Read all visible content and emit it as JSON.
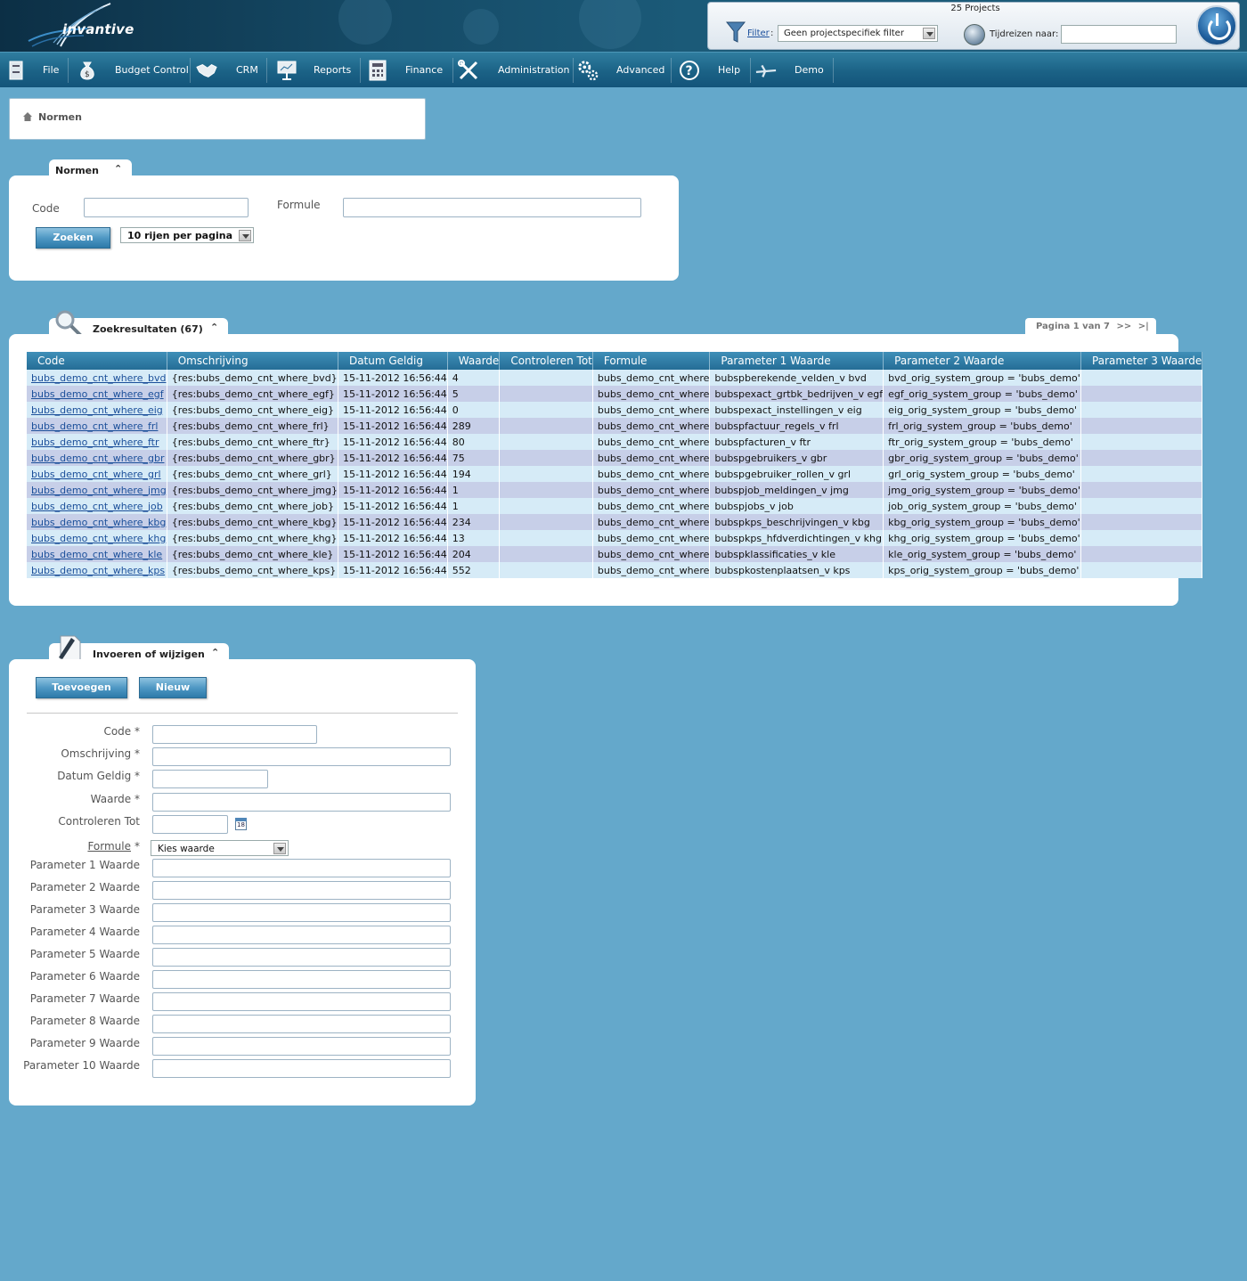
{
  "header": {
    "logo_text": "invantive",
    "project_count": "25 Projects",
    "filter_link": "Filter",
    "filter_colon": ":",
    "filter_value": "Geen projectspecifiek filter",
    "time_travel_label": "Tijdreizen naar:",
    "time_travel_value": ""
  },
  "menu": [
    {
      "label": "File",
      "icon": "cabinet-icon"
    },
    {
      "label": "Budget Control",
      "icon": "money-bag-icon"
    },
    {
      "label": "CRM",
      "icon": "handshake-icon"
    },
    {
      "label": "Reports",
      "icon": "presentation-icon"
    },
    {
      "label": "Finance",
      "icon": "calculator-icon"
    },
    {
      "label": "Administration",
      "icon": "tools-icon"
    },
    {
      "label": "Advanced",
      "icon": "gears-icon"
    },
    {
      "label": "Help",
      "icon": "question-icon"
    },
    {
      "label": "Demo",
      "icon": "airplane-icon"
    }
  ],
  "breadcrumb": {
    "text": "Normen"
  },
  "search": {
    "tab_title": "Normen",
    "code_label": "Code",
    "formule_label": "Formule",
    "search_button": "Zoeken",
    "rows_select": "10 rijen per pagina"
  },
  "results": {
    "tab_title": "Zoekresultaten (67)",
    "pager": "Pagina 1 van 7",
    "pager_next": ">>",
    "pager_last": ">|",
    "columns": [
      "Code",
      "Omschrijving",
      "Datum Geldig",
      "Waarde",
      "Controleren Tot",
      "Formule",
      "Parameter 1 Waarde",
      "Parameter 2 Waarde",
      "Parameter 3 Waarde"
    ],
    "rows": [
      [
        "bubs_demo_cnt_where_bvd",
        "{res:bubs_demo_cnt_where_bvd}",
        "15-11-2012 16:56:44",
        "4",
        "",
        "bubs_demo_cnt_where",
        "bubspberekende_velden_v bvd",
        "bvd_orig_system_group = 'bubs_demo'",
        ""
      ],
      [
        "bubs_demo_cnt_where_egf",
        "{res:bubs_demo_cnt_where_egf}",
        "15-11-2012 16:56:44",
        "5",
        "",
        "bubs_demo_cnt_where",
        "bubspexact_grtbk_bedrijven_v egf",
        "egf_orig_system_group = 'bubs_demo'",
        ""
      ],
      [
        "bubs_demo_cnt_where_eig",
        "{res:bubs_demo_cnt_where_eig}",
        "15-11-2012 16:56:44",
        "0",
        "",
        "bubs_demo_cnt_where",
        "bubspexact_instellingen_v eig",
        "eig_orig_system_group = 'bubs_demo'",
        ""
      ],
      [
        "bubs_demo_cnt_where_frl",
        "{res:bubs_demo_cnt_where_frl}",
        "15-11-2012 16:56:44",
        "289",
        "",
        "bubs_demo_cnt_where",
        "bubspfactuur_regels_v frl",
        "frl_orig_system_group = 'bubs_demo'",
        ""
      ],
      [
        "bubs_demo_cnt_where_ftr",
        "{res:bubs_demo_cnt_where_ftr}",
        "15-11-2012 16:56:44",
        "80",
        "",
        "bubs_demo_cnt_where",
        "bubspfacturen_v ftr",
        "ftr_orig_system_group = 'bubs_demo'",
        ""
      ],
      [
        "bubs_demo_cnt_where_gbr",
        "{res:bubs_demo_cnt_where_gbr}",
        "15-11-2012 16:56:44",
        "75",
        "",
        "bubs_demo_cnt_where",
        "bubspgebruikers_v gbr",
        "gbr_orig_system_group = 'bubs_demo'",
        ""
      ],
      [
        "bubs_demo_cnt_where_grl",
        "{res:bubs_demo_cnt_where_grl}",
        "15-11-2012 16:56:44",
        "194",
        "",
        "bubs_demo_cnt_where",
        "bubspgebruiker_rollen_v grl",
        "grl_orig_system_group = 'bubs_demo'",
        ""
      ],
      [
        "bubs_demo_cnt_where_jmg",
        "{res:bubs_demo_cnt_where_jmg}",
        "15-11-2012 16:56:44",
        "1",
        "",
        "bubs_demo_cnt_where",
        "bubspjob_meldingen_v jmg",
        "jmg_orig_system_group = 'bubs_demo'",
        ""
      ],
      [
        "bubs_demo_cnt_where_job",
        "{res:bubs_demo_cnt_where_job}",
        "15-11-2012 16:56:44",
        "1",
        "",
        "bubs_demo_cnt_where",
        "bubspjobs_v job",
        "job_orig_system_group = 'bubs_demo'",
        ""
      ],
      [
        "bubs_demo_cnt_where_kbg",
        "{res:bubs_demo_cnt_where_kbg}",
        "15-11-2012 16:56:44",
        "234",
        "",
        "bubs_demo_cnt_where",
        "bubspkps_beschrijvingen_v kbg",
        "kbg_orig_system_group = 'bubs_demo'",
        ""
      ],
      [
        "bubs_demo_cnt_where_khg",
        "{res:bubs_demo_cnt_where_khg}",
        "15-11-2012 16:56:44",
        "13",
        "",
        "bubs_demo_cnt_where",
        "bubspkps_hfdverdichtingen_v khg",
        "khg_orig_system_group = 'bubs_demo'",
        ""
      ],
      [
        "bubs_demo_cnt_where_kle",
        "{res:bubs_demo_cnt_where_kle}",
        "15-11-2012 16:56:44",
        "204",
        "",
        "bubs_demo_cnt_where",
        "bubspklassificaties_v kle",
        "kle_orig_system_group = 'bubs_demo'",
        ""
      ],
      [
        "bubs_demo_cnt_where_kps",
        "{res:bubs_demo_cnt_where_kps}",
        "15-11-2012 16:56:44",
        "552",
        "",
        "bubs_demo_cnt_where",
        "bubspkostenplaatsen_v kps",
        "kps_orig_system_group = 'bubs_demo'",
        ""
      ]
    ]
  },
  "edit": {
    "tab_title": "Invoeren of wijzigen",
    "add_button": "Toevoegen",
    "new_button": "Nieuw",
    "formule_select": "Kies waarde",
    "fields": [
      {
        "label": "Code *"
      },
      {
        "label": "Omschrijving *"
      },
      {
        "label": "Datum Geldig *"
      },
      {
        "label": "Waarde *"
      },
      {
        "label": "Controleren Tot"
      },
      {
        "label": "Formule"
      },
      {
        "label": "Parameter 1 Waarde"
      },
      {
        "label": "Parameter 2 Waarde"
      },
      {
        "label": "Parameter 3 Waarde"
      },
      {
        "label": "Parameter 4 Waarde"
      },
      {
        "label": "Parameter 5 Waarde"
      },
      {
        "label": "Parameter 6 Waarde"
      },
      {
        "label": "Parameter 7 Waarde"
      },
      {
        "label": "Parameter 8 Waarde"
      },
      {
        "label": "Parameter 9 Waarde"
      },
      {
        "label": "Parameter 10 Waarde"
      }
    ],
    "formule_star": "*",
    "calendar_icon_text": "18"
  }
}
